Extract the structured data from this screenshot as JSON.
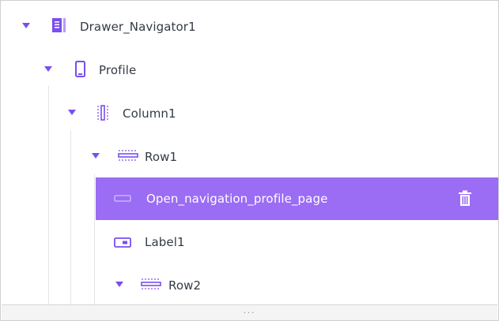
{
  "tree": {
    "items": [
      {
        "label": "Drawer_Navigator1",
        "icon": "drawer-navigator-icon",
        "expanded": true
      },
      {
        "label": "Profile",
        "icon": "screen-icon",
        "expanded": true
      },
      {
        "label": "Column1",
        "icon": "column-layout-icon",
        "expanded": true
      },
      {
        "label": "Row1",
        "icon": "row-layout-icon",
        "expanded": true
      },
      {
        "label": "Open_navigation_profile_page",
        "icon": "button-icon",
        "selected": true
      },
      {
        "label": "Label1",
        "icon": "label-icon"
      },
      {
        "label": "Row2",
        "icon": "row-layout-icon",
        "expanded": true
      }
    ],
    "selected_action_icon": "trash-icon"
  },
  "colors": {
    "accent": "#7a4ef0",
    "selected_background": "#9b6cf4",
    "text": "#333a45"
  },
  "footer": {
    "resize_handle": "..."
  }
}
